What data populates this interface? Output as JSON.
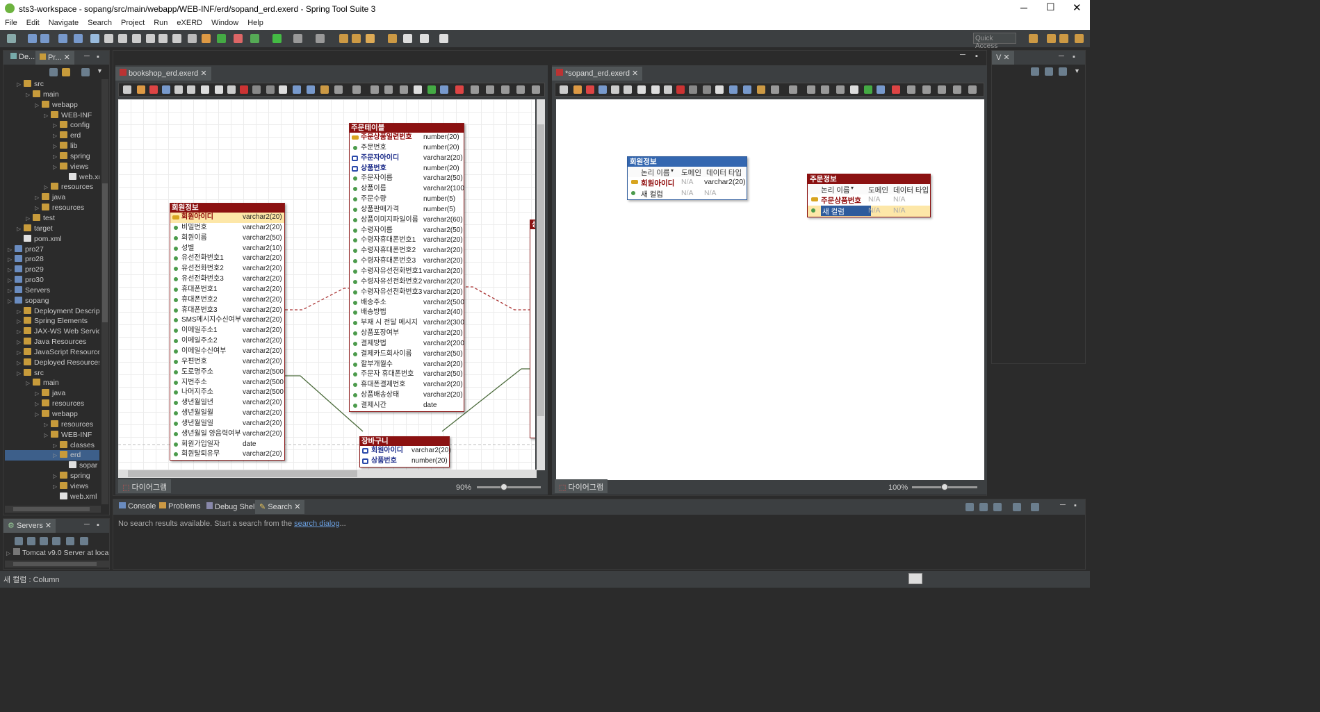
{
  "window": {
    "title": "sts3-workspace - sopang/src/main/webapp/WEB-INF/erd/sopand_erd.exerd - Spring Tool Suite 3"
  },
  "menu": [
    "File",
    "Edit",
    "Navigate",
    "Search",
    "Project",
    "Run",
    "eXERD",
    "Window",
    "Help"
  ],
  "quick_access": "Quick Access",
  "left_tabs": [
    "De...",
    "Pr..."
  ],
  "tree": [
    {
      "label": "src",
      "indent": 1
    },
    {
      "label": "main",
      "indent": 2
    },
    {
      "label": "webapp",
      "indent": 3
    },
    {
      "label": "WEB-INF",
      "indent": 4
    },
    {
      "label": "config",
      "indent": 5
    },
    {
      "label": "erd",
      "indent": 5
    },
    {
      "label": "lib",
      "indent": 5
    },
    {
      "label": "spring",
      "indent": 5
    },
    {
      "label": "views",
      "indent": 5
    },
    {
      "label": "web.xml",
      "indent": 6
    },
    {
      "label": "resources",
      "indent": 4
    },
    {
      "label": "java",
      "indent": 3
    },
    {
      "label": "resources",
      "indent": 3
    },
    {
      "label": "test",
      "indent": 2
    },
    {
      "label": "target",
      "indent": 1
    },
    {
      "label": "pom.xml",
      "indent": 1
    },
    {
      "label": "pro27",
      "indent": 0
    },
    {
      "label": "pro28",
      "indent": 0
    },
    {
      "label": "pro29",
      "indent": 0
    },
    {
      "label": "pro30",
      "indent": 0
    },
    {
      "label": "Servers",
      "indent": 0
    },
    {
      "label": "sopang",
      "indent": 0
    },
    {
      "label": "Deployment Descrip",
      "indent": 1
    },
    {
      "label": "Spring Elements",
      "indent": 1
    },
    {
      "label": "JAX-WS Web Service",
      "indent": 1
    },
    {
      "label": "Java Resources",
      "indent": 1
    },
    {
      "label": "JavaScript Resources",
      "indent": 1
    },
    {
      "label": "Deployed Resources",
      "indent": 1
    },
    {
      "label": "src",
      "indent": 1
    },
    {
      "label": "main",
      "indent": 2
    },
    {
      "label": "java",
      "indent": 3
    },
    {
      "label": "resources",
      "indent": 3
    },
    {
      "label": "webapp",
      "indent": 3
    },
    {
      "label": "resources",
      "indent": 4
    },
    {
      "label": "WEB-INF",
      "indent": 4
    },
    {
      "label": "classes",
      "indent": 5
    },
    {
      "label": "erd",
      "indent": 5
    },
    {
      "label": "sopar",
      "indent": 6
    },
    {
      "label": "spring",
      "indent": 5
    },
    {
      "label": "views",
      "indent": 5
    },
    {
      "label": "web.xml",
      "indent": 5
    }
  ],
  "servers": {
    "tab": "Servers",
    "item": "Tomcat v9.0 Server at loca"
  },
  "editor1": {
    "tab": "bookshop_erd.exerd",
    "footer_tab": "다이어그램",
    "zoom": "90%"
  },
  "editor2": {
    "tab": "*sopand_erd.exerd",
    "footer_tab": "다이어그램",
    "zoom": "100%"
  },
  "side_tab": "V",
  "entity_member": {
    "title": "회원정보",
    "rows": [
      [
        "pk",
        "회원아이디",
        "varchar2(20)"
      ],
      [
        "c",
        "비밀번호",
        "varchar2(20)"
      ],
      [
        "c",
        "회원이름",
        "varchar2(50)"
      ],
      [
        "c",
        "성별",
        "varchar2(10)"
      ],
      [
        "c",
        "유선전화번호1",
        "varchar2(20)"
      ],
      [
        "c",
        "유선전화번호2",
        "varchar2(20)"
      ],
      [
        "c",
        "유선전화번호3",
        "varchar2(20)"
      ],
      [
        "c",
        "휴대폰번호1",
        "varchar2(20)"
      ],
      [
        "c",
        "휴대폰번호2",
        "varchar2(20)"
      ],
      [
        "c",
        "휴대폰번호3",
        "varchar2(20)"
      ],
      [
        "c",
        "SMS메시지수신여부",
        "varchar2(20)"
      ],
      [
        "c",
        "이메일주소1",
        "varchar2(20)"
      ],
      [
        "c",
        "이메일주소2",
        "varchar2(20)"
      ],
      [
        "c",
        "이메일수신여부",
        "varchar2(20)"
      ],
      [
        "c",
        "우편번호",
        "varchar2(20)"
      ],
      [
        "c",
        "도로명주소",
        "varchar2(500"
      ],
      [
        "c",
        "지번주소",
        "varchar2(500"
      ],
      [
        "c",
        "나머지주소",
        "varchar2(500"
      ],
      [
        "c",
        "생년월일년",
        "varchar2(20)"
      ],
      [
        "c",
        "생년월일월",
        "varchar2(20)"
      ],
      [
        "c",
        "생년월일일",
        "varchar2(20)"
      ],
      [
        "c",
        "생년월일 양음력여부",
        "varchar2(20)"
      ],
      [
        "c",
        "회원가입일자",
        "date"
      ],
      [
        "c",
        "회원탈퇴유무",
        "varchar2(20)"
      ]
    ]
  },
  "entity_order": {
    "title": "주문테이블",
    "rows": [
      [
        "pk",
        "주문상품일련번호",
        "number(20)"
      ],
      [
        "c",
        "주문번호",
        "number(20)"
      ],
      [
        "fk",
        "주문자아이디",
        "varchar2(20)"
      ],
      [
        "fk",
        "상품번호",
        "number(20)"
      ],
      [
        "c",
        "주문자이름",
        "varchar2(50)"
      ],
      [
        "c",
        "상품이름",
        "varchar2(100"
      ],
      [
        "c",
        "주문수량",
        "number(5)"
      ],
      [
        "c",
        "상품판매가격",
        "number(5)"
      ],
      [
        "c",
        "상품이미지파일이름",
        "varchar2(60)"
      ],
      [
        "c",
        "수령자이름",
        "varchar2(50)"
      ],
      [
        "c",
        "수령자휴대폰번호1",
        "varchar2(20)"
      ],
      [
        "c",
        "수령자휴대폰번호2",
        "varchar2(20)"
      ],
      [
        "c",
        "수령자휴대폰번호3",
        "varchar2(20)"
      ],
      [
        "c",
        "수령자유선전화번호1",
        "varchar2(20)"
      ],
      [
        "c",
        "수령자유선전화번호2",
        "varchar2(20)"
      ],
      [
        "c",
        "수령자유선전화번호3",
        "varchar2(20)"
      ],
      [
        "c",
        "배송주소",
        "varchar2(500"
      ],
      [
        "c",
        "배송방법",
        "varchar2(40)"
      ],
      [
        "c",
        "부재 시 전달 메시지",
        "varchar2(300"
      ],
      [
        "c",
        "상품포장여부",
        "varchar2(20)"
      ],
      [
        "c",
        "결제방법",
        "varchar2(200"
      ],
      [
        "c",
        "결제카드회사이름",
        "varchar2(50)"
      ],
      [
        "c",
        "할부개월수",
        "varchar2(20)"
      ],
      [
        "c",
        "주문자 휴대폰번호",
        "varchar2(50)"
      ],
      [
        "c",
        "휴대폰결제번호",
        "varchar2(20)"
      ],
      [
        "c",
        "상품배송상태",
        "varchar2(20)"
      ],
      [
        "c",
        "결제시간",
        "date"
      ]
    ]
  },
  "entity_cart": {
    "title": "장바구니",
    "rows": [
      [
        "fk",
        "회원아이디",
        "varchar2(20)"
      ],
      [
        "fk",
        "상품번호",
        "number(20)"
      ]
    ]
  },
  "entity_right_partial": {
    "title": "상"
  },
  "sopang_member": {
    "title": "회원정보",
    "header": [
      "논리 이름",
      "도메인",
      "데이터 타입"
    ],
    "rows": [
      [
        "pk",
        "회원아이디",
        "N/A",
        "varchar2(20)"
      ],
      [
        "c",
        "새 컬럼",
        "N/A",
        "N/A"
      ]
    ]
  },
  "sopang_order": {
    "title": "주문정보",
    "header": [
      "논리 이름",
      "도메인",
      "데이터 타입"
    ],
    "rows": [
      [
        "pk",
        "주문상품번호",
        "N/A",
        "N/A"
      ],
      [
        "c",
        "새 컬럼",
        "N/A",
        "N/A"
      ]
    ]
  },
  "bottom_tabs": [
    "Console",
    "Problems",
    "Debug Shell",
    "Search"
  ],
  "search_msg": "No search results available. Start a search from the ",
  "search_link": "search dialog",
  "search_tail": "...",
  "status": "새 컬럼 : Column",
  "colors": {
    "accent": "#8b1111",
    "fk": "#1d2d8a",
    "selected": "#2d5b9c"
  }
}
